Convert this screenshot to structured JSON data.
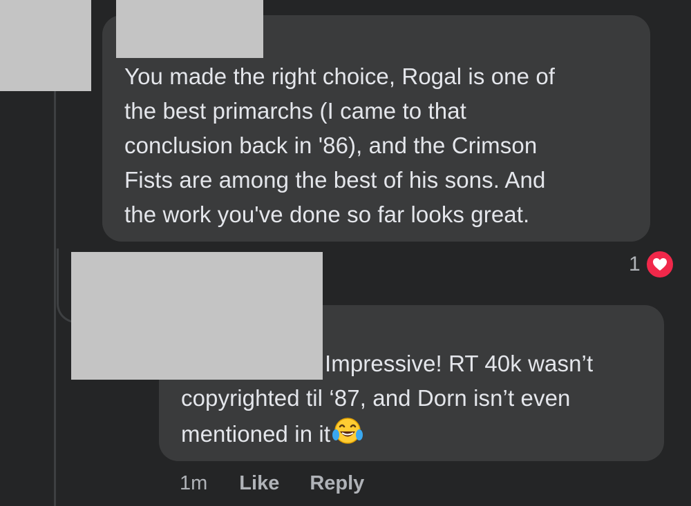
{
  "parent_comment": {
    "text": "You made the right choice, Rogal is one of the best primarchs (I came to that conclusion back in '86), and the Crimson Fists are among the best of his sons. And the work you've done so far looks great.",
    "lines": [
      "You made the right choice, Rogal is one of",
      "the best primarchs (I came to that",
      "conclusion back in '86), and the Crimson",
      "Fists are among the best of his sons. And",
      "the work you've done so far looks great."
    ],
    "reaction_count": "1",
    "reaction_icon": "heart-icon"
  },
  "reply_comment": {
    "lines": [
      "Impressive! RT 40k wasn’t",
      "copyrighted til ‘87, and Dorn isn’t even",
      "mentioned in it"
    ],
    "emoji": "face-with-tears-of-joy-icon"
  },
  "reply_actions": {
    "time": "1m",
    "like_label": "Like",
    "reply_label": "Reply"
  },
  "colors": {
    "background": "#242526",
    "bubble": "#3a3b3c",
    "text": "#e4e6eb",
    "secondary_text": "#b0b3b8",
    "heart": "#f0284a",
    "redaction": "#c4c4c4"
  }
}
